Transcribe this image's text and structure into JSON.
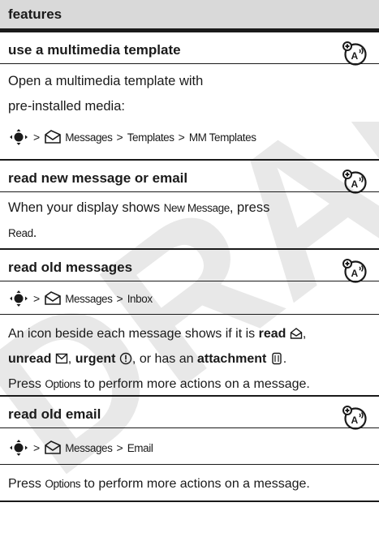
{
  "header": {
    "title": "features"
  },
  "sections": [
    {
      "title": "use a multimedia template",
      "body_lines": [
        "Open a multimedia template with",
        "pre-installed media:"
      ],
      "path": [
        "Messages",
        "Templates",
        "MM Templates"
      ]
    },
    {
      "title": "read new message or email",
      "line1_pre": "When your display shows ",
      "line1_key": "New Message",
      "line1_post": ", press",
      "line2_key": "Read",
      "line2_post": "."
    },
    {
      "title": "read old messages",
      "path": [
        "Messages",
        "Inbox"
      ],
      "desc_pre": "An icon beside each message shows if it is ",
      "read": "read",
      "unread": "unread",
      "urgent": "urgent",
      "mid": ", or has an ",
      "attachment": "attachment",
      "press": "Press ",
      "options": "Options",
      "press_post": " to perform more actions on a message."
    },
    {
      "title": "read old email",
      "path": [
        "Messages",
        "Email"
      ],
      "press": "Press ",
      "options": "Options",
      "press_post": " to perform more actions on a message."
    }
  ],
  "nav": {
    "separator": ">"
  },
  "colors": {
    "header_bg": "#d9d9d9",
    "rule": "#1a1a1a",
    "watermark": "#e6e6e6"
  },
  "icons": [
    "nav-key-icon",
    "messages-icon",
    "network-feature-icon",
    "read-message-icon",
    "unread-message-icon",
    "urgent-icon",
    "attachment-icon"
  ]
}
